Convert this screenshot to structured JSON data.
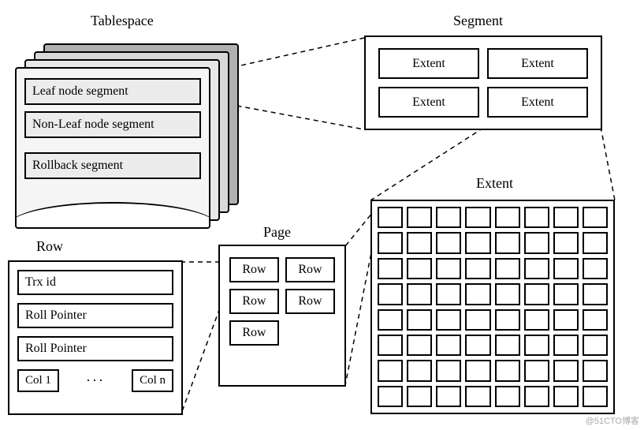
{
  "labels": {
    "tablespace": "Tablespace",
    "segment": "Segment",
    "extent": "Extent",
    "page": "Page",
    "row": "Row"
  },
  "tablespace_segments": {
    "leaf": "Leaf node segment",
    "nonleaf": "Non-Leaf node segment",
    "rollback": "Rollback segment"
  },
  "segment_box": {
    "extent_label": "Extent"
  },
  "page_box": {
    "row_label": "Row"
  },
  "row_box": {
    "trx_id": "Trx id",
    "roll_pointer_1": "Roll Pointer",
    "roll_pointer_2": "Roll Pointer",
    "col_first": "Col 1",
    "col_ellipsis": "···",
    "col_last": "Col n"
  },
  "watermark": "@51CTO博客"
}
